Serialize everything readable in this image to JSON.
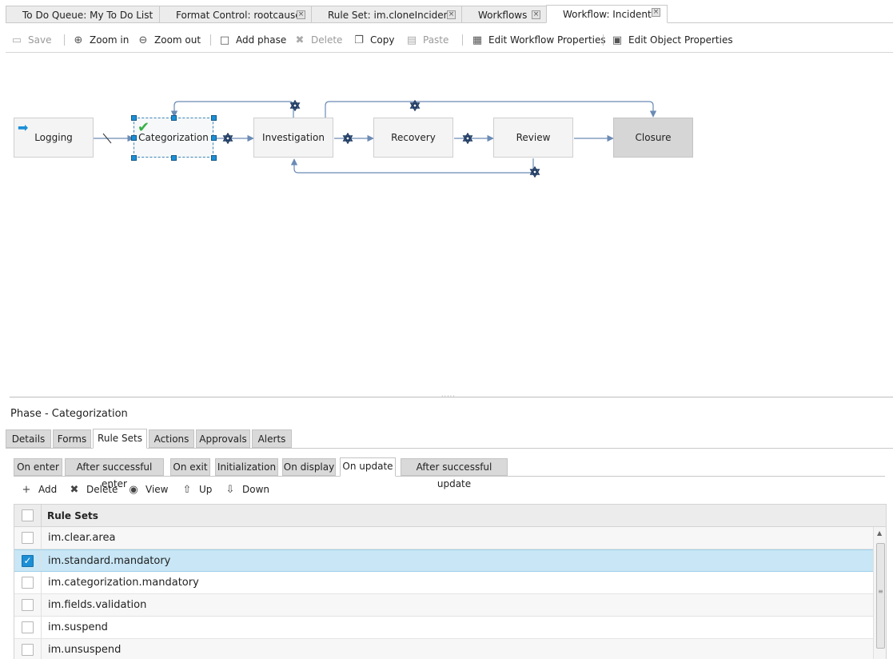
{
  "doc_tabs": [
    {
      "label": "To Do Queue: My To Do List",
      "closable": false,
      "active": false
    },
    {
      "label": "Format Control: rootcause",
      "closable": true,
      "active": false
    },
    {
      "label": "Rule Set: im.cloneIncident",
      "closable": true,
      "active": false
    },
    {
      "label": "Workflows",
      "closable": true,
      "active": false
    },
    {
      "label": "Workflow: Incident",
      "closable": true,
      "active": true
    }
  ],
  "close_glyph": "×",
  "toolbar": {
    "save": "Save",
    "zoom_in": "Zoom in",
    "zoom_out": "Zoom out",
    "add_phase": "Add phase",
    "delete": "Delete",
    "copy": "Copy",
    "paste": "Paste",
    "edit_workflow_properties": "Edit Workflow Properties",
    "edit_object_properties": "Edit Object Properties"
  },
  "workflow": {
    "phases": [
      "Logging",
      "Categorization",
      "Investigation",
      "Recovery",
      "Review",
      "Closure"
    ],
    "selected_phase": "Categorization",
    "start_phase": "Logging",
    "final_phase": "Closure"
  },
  "panel": {
    "title": "Phase - Categorization",
    "tabs": [
      "Details",
      "Forms",
      "Rule Sets",
      "Actions",
      "Approvals",
      "Alerts"
    ],
    "active_tab": "Rule Sets",
    "event_tabs": [
      "On enter",
      "After successful enter",
      "On exit",
      "Initialization",
      "On display",
      "On update",
      "After successful update"
    ],
    "active_event_tab": "On update",
    "list_tools": {
      "add": "Add",
      "delete": "Delete",
      "view": "View",
      "up": "Up",
      "down": "Down"
    },
    "grid": {
      "column": "Rule Sets",
      "rows": [
        {
          "name": "im.clear.area",
          "checked": false
        },
        {
          "name": "im.standard.mandatory",
          "checked": true
        },
        {
          "name": "im.categorization.mandatory",
          "checked": false
        },
        {
          "name": "im.fields.validation",
          "checked": false
        },
        {
          "name": "im.suspend",
          "checked": false
        },
        {
          "name": "im.unsuspend",
          "checked": false
        }
      ]
    }
  },
  "colors": {
    "accent": "#1b8fd6",
    "selected_row": "#c8e6f5",
    "connector": "#6b8bb5",
    "check": "#39b04a"
  }
}
